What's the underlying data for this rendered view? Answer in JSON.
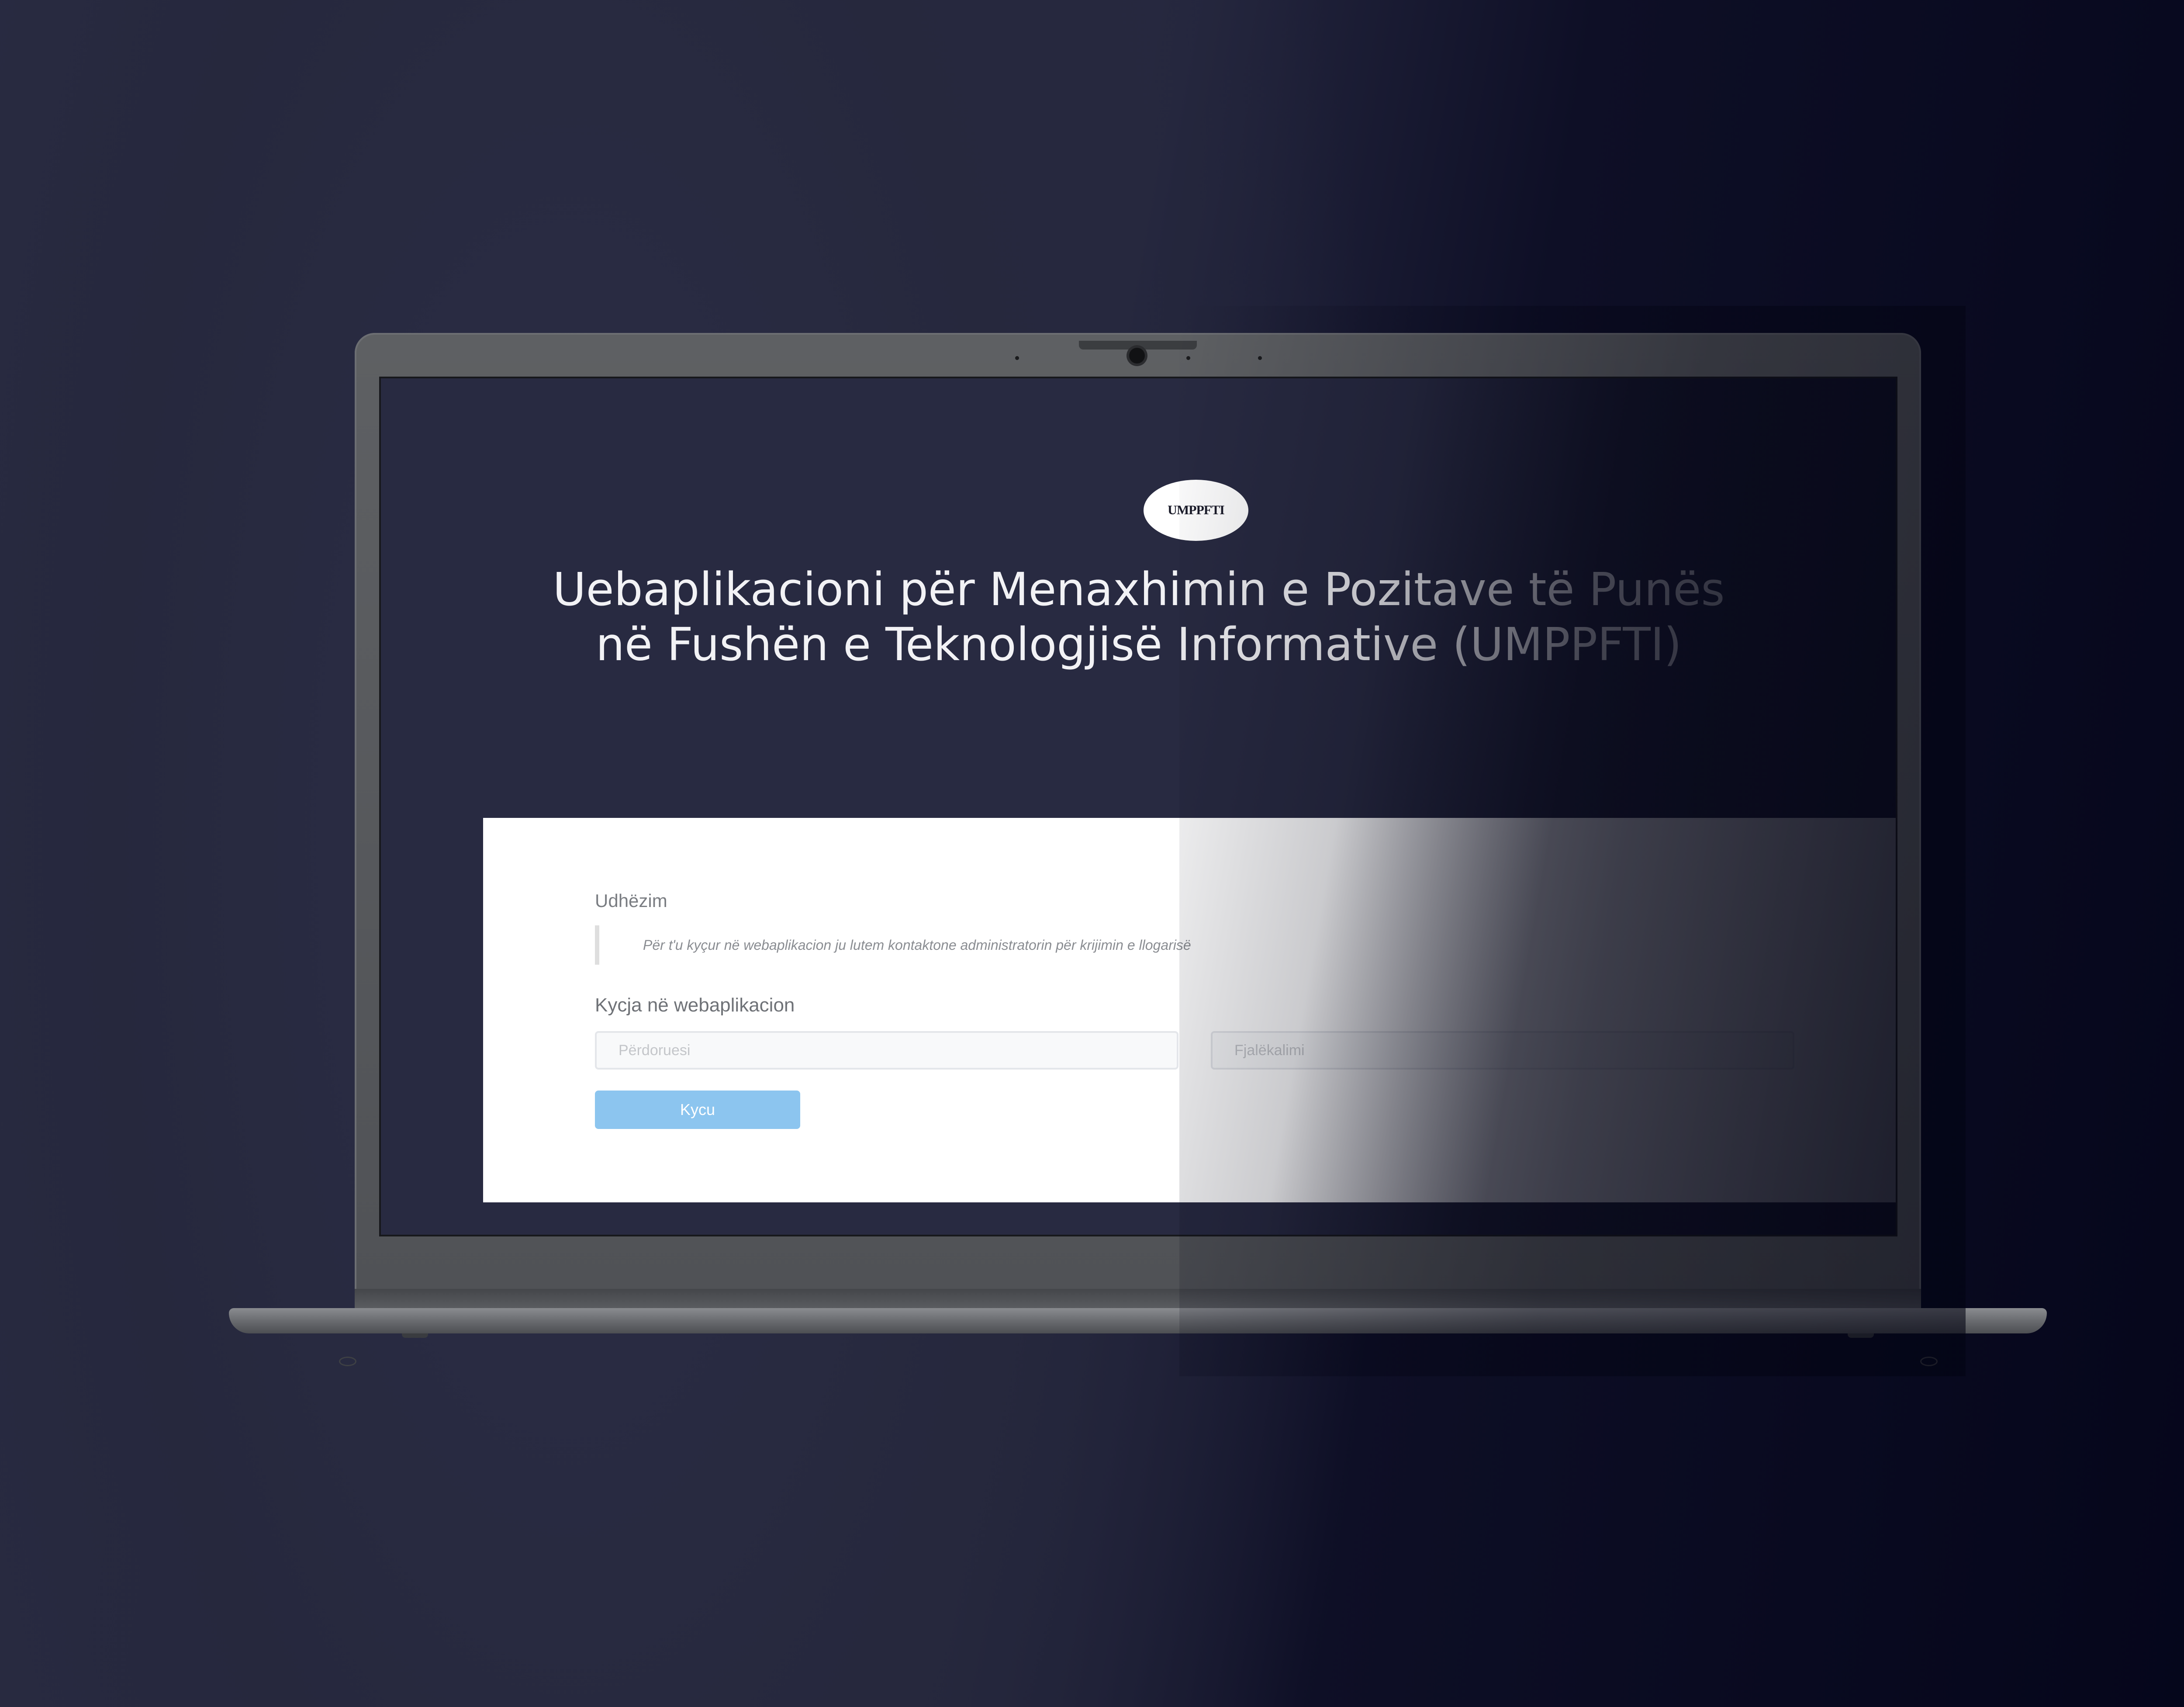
{
  "app": {
    "logo_text": "UMPPFTI",
    "title": "Uebaplikacioni për Menaxhimin e Pozitave të Punës në Fushën e Teknologjisë Informative (UMPPFTI)"
  },
  "guide": {
    "label": "Udhëzim",
    "text": "Për t'u kyçur në webaplikacion ju lutem kontaktone administratorin për krijimin e llogarisë"
  },
  "login": {
    "label": "Kycja në webaplikacion",
    "username_placeholder": "Përdoruesi",
    "password_placeholder": "Fjalëkalimi",
    "button_label": "Kycu"
  },
  "colors": {
    "background": "#282a40",
    "screen_background": "#282a41",
    "panel": "#ffffff",
    "button": "#8cc5ef"
  }
}
